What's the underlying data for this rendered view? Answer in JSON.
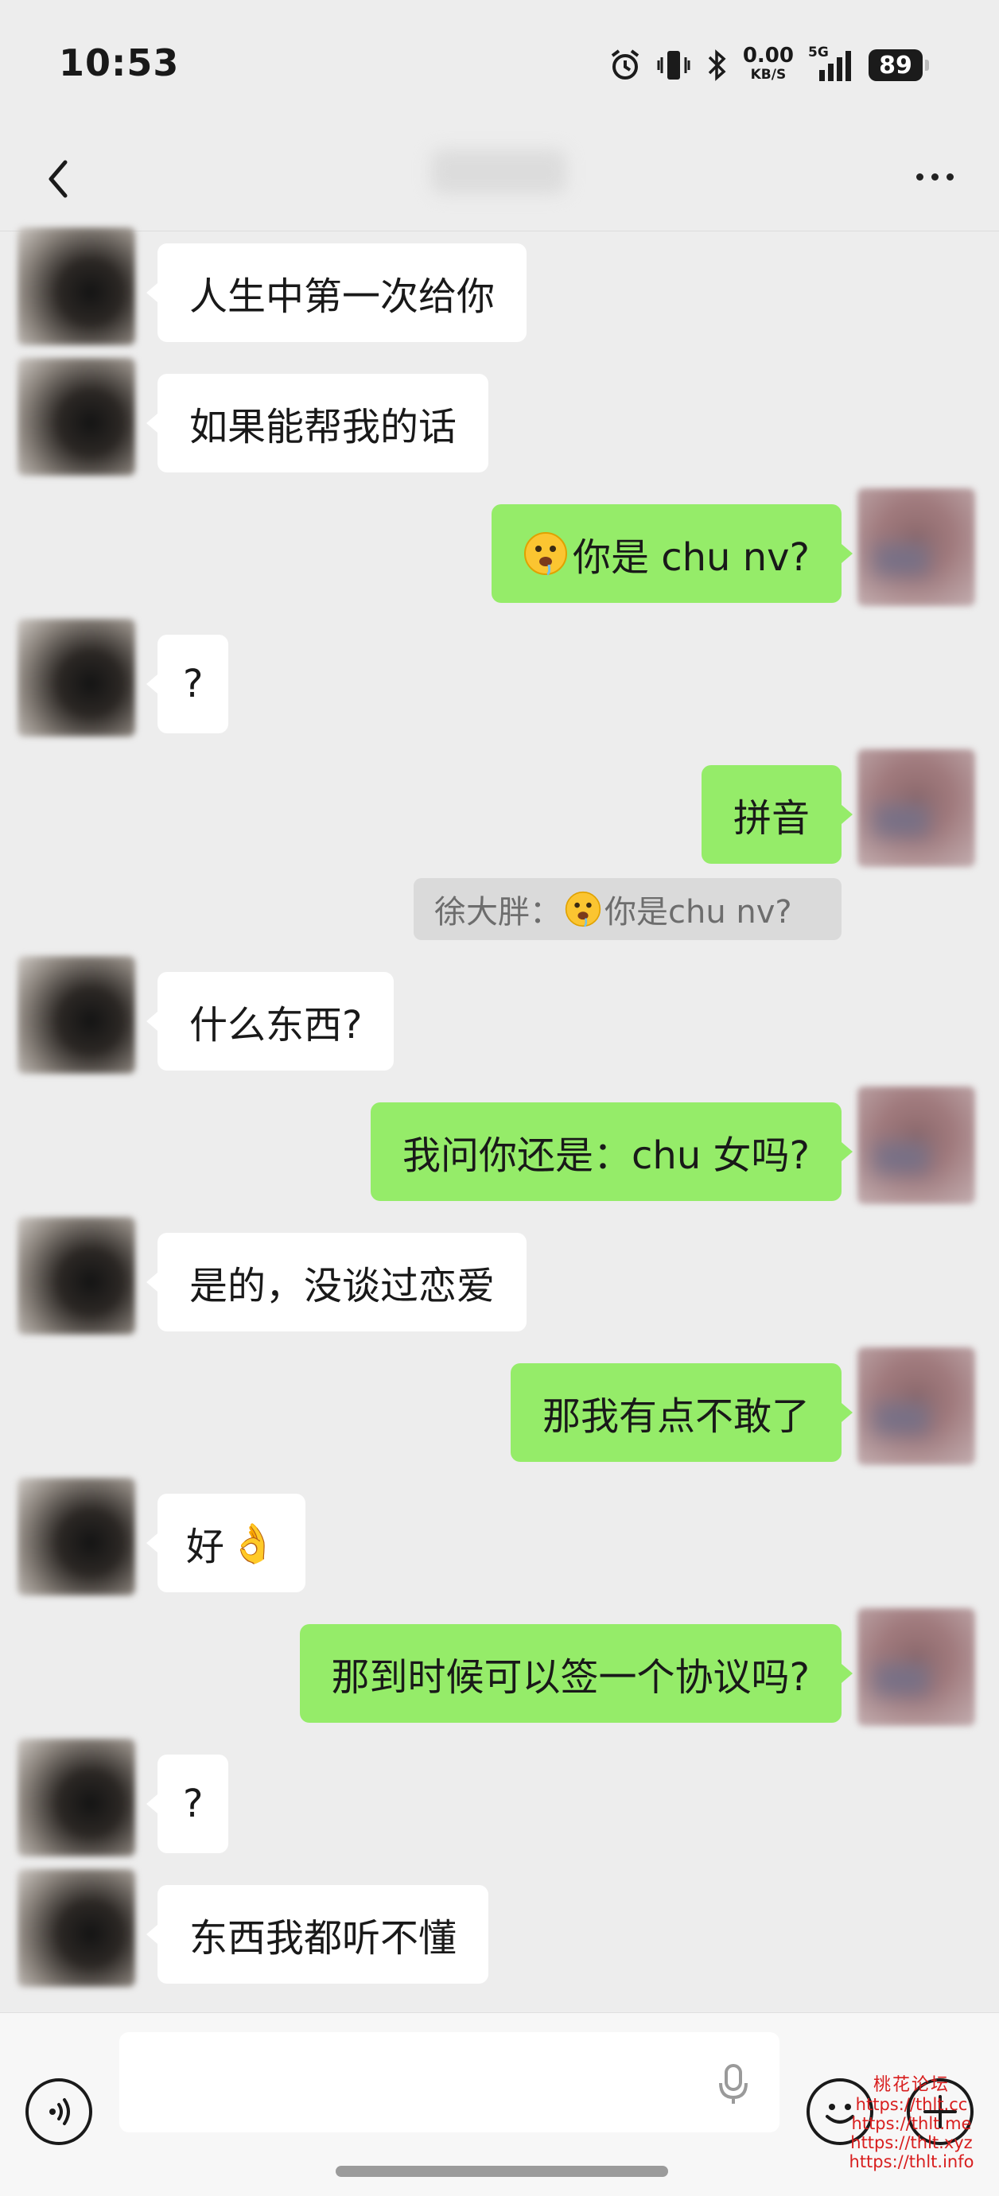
{
  "status_bar": {
    "time": "10:53",
    "net_speed": "0.00",
    "net_unit": "KB/S",
    "network": "5G",
    "battery": "89"
  },
  "nav": {
    "title": "",
    "back_icon": "chevron-left-icon",
    "more_icon": "ellipsis-icon"
  },
  "messages": [
    {
      "side": "left",
      "text": "人生中第一次给你"
    },
    {
      "side": "left",
      "text": "如果能帮我的话"
    },
    {
      "side": "right",
      "emoji": "drooling-face",
      "text": "你是 chu nv?"
    },
    {
      "side": "left",
      "text": "?"
    },
    {
      "side": "right",
      "text": "拼音"
    },
    {
      "side": "left",
      "text": "什么东西?"
    },
    {
      "side": "right",
      "text": "我问你还是：chu 女吗?"
    },
    {
      "side": "left",
      "text": "是的，没谈过恋爱"
    },
    {
      "side": "right",
      "text": "那我有点不敢了"
    },
    {
      "side": "left",
      "text": "好",
      "emoji": "ok-hand"
    },
    {
      "side": "right",
      "text": "那到时候可以签一个协议吗?"
    },
    {
      "side": "left",
      "text": "?"
    },
    {
      "side": "left",
      "text": "东西我都听不懂"
    }
  ],
  "quote": {
    "sender": "徐大胖：",
    "text": "你是chu nv?"
  },
  "input": {
    "placeholder": "",
    "voice_icon": "voice-toggle-icon",
    "mic_icon": "microphone-icon",
    "emoji_icon": "emoji-icon",
    "plus_icon": "plus-icon"
  },
  "watermark": {
    "title": "桃花论坛",
    "urls": [
      "https://thlt.cc",
      "https://thlt.me",
      "https://thlt.xyz",
      "https://thlt.info"
    ]
  },
  "colors": {
    "background": "#ededed",
    "sent_bubble": "#95ec69",
    "received_bubble": "#ffffff",
    "quote_bg": "#dadada"
  }
}
